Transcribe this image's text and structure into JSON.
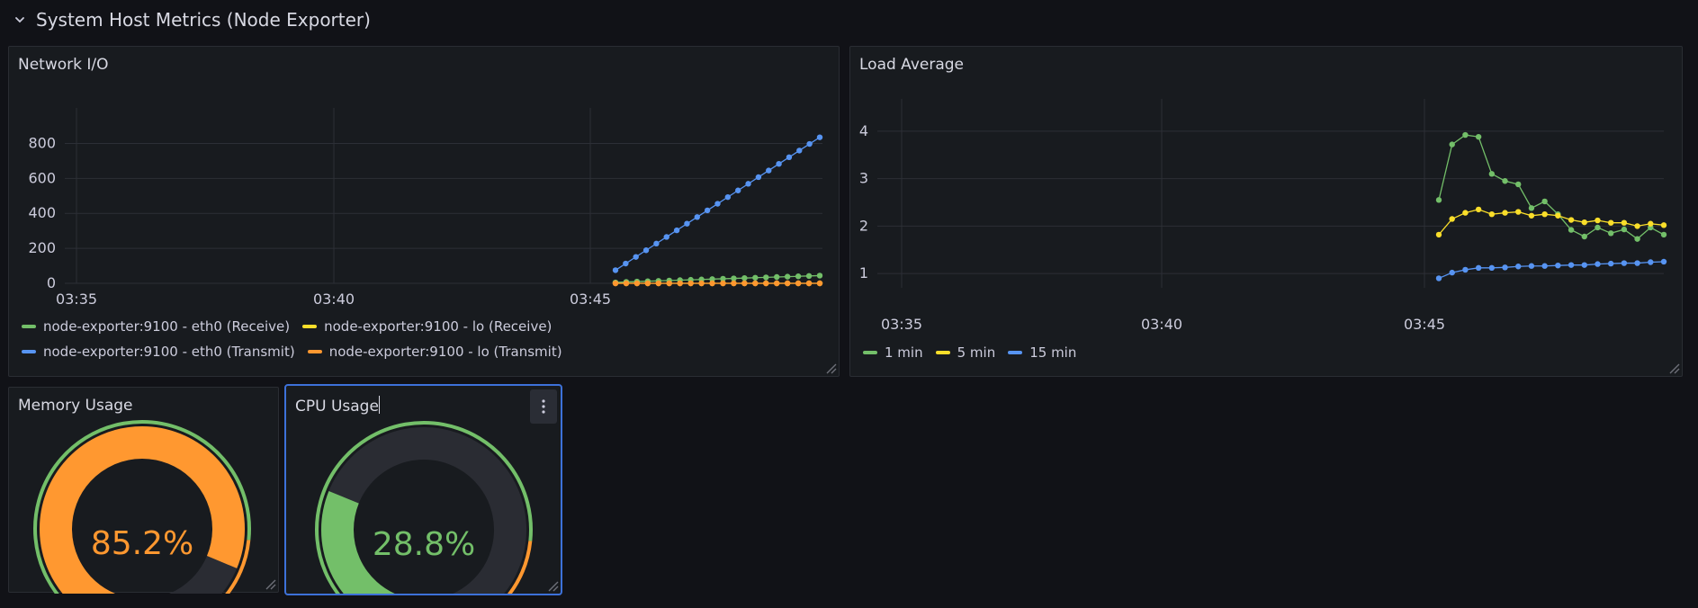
{
  "row": {
    "title": "System Host Metrics (Node Exporter)"
  },
  "colors": {
    "green": "#73bf69",
    "yellow": "#fade2a",
    "blue": "#5794f2",
    "orange": "#ff9830",
    "red": "#f2495c",
    "track": "#2a2c33"
  },
  "network": {
    "title": "Network I/O",
    "legend": [
      {
        "label": "node-exporter:9100 - eth0 (Receive)",
        "color": "#73bf69"
      },
      {
        "label": "node-exporter:9100 - lo (Receive)",
        "color": "#fade2a"
      },
      {
        "label": "node-exporter:9100 - eth0 (Transmit)",
        "color": "#5794f2"
      },
      {
        "label": "node-exporter:9100 - lo (Transmit)",
        "color": "#ff9830"
      }
    ],
    "chart_data": {
      "type": "line",
      "xlabels": [
        "03:35",
        "03:40",
        "03:45"
      ],
      "ylim": [
        0,
        900
      ],
      "yticks": [
        0,
        200,
        400,
        600,
        800
      ],
      "series": [
        {
          "name": "node-exporter:9100 - eth0 (Receive)",
          "color": "#73bf69",
          "values": [
            5,
            8,
            10,
            12,
            14,
            16,
            18,
            20,
            22,
            24,
            26,
            28,
            30,
            32,
            34,
            36,
            38,
            40,
            42,
            44
          ]
        },
        {
          "name": "node-exporter:9100 - lo (Receive)",
          "color": "#fade2a",
          "values": [
            0,
            0,
            0,
            0,
            0,
            0,
            0,
            0,
            0,
            0,
            0,
            0,
            0,
            0,
            0,
            0,
            0,
            0,
            0,
            0
          ]
        },
        {
          "name": "node-exporter:9100 - eth0 (Transmit)",
          "color": "#5794f2",
          "values": [
            75,
            113,
            151,
            189,
            227,
            265,
            303,
            341,
            379,
            417,
            455,
            493,
            531,
            569,
            607,
            645,
            683,
            721,
            759,
            797,
            835
          ]
        },
        {
          "name": "node-exporter:9100 - lo (Transmit)",
          "color": "#ff9830",
          "values": [
            0,
            0,
            0,
            0,
            0,
            0,
            0,
            0,
            0,
            0,
            0,
            0,
            0,
            0,
            0,
            0,
            0,
            0,
            0,
            0
          ]
        }
      ]
    }
  },
  "load": {
    "title": "Load Average",
    "legend": [
      {
        "label": "1 min",
        "color": "#73bf69"
      },
      {
        "label": "5 min",
        "color": "#fade2a"
      },
      {
        "label": "15 min",
        "color": "#5794f2"
      }
    ],
    "chart_data": {
      "type": "line",
      "xlabels": [
        "03:35",
        "03:40",
        "03:45"
      ],
      "ylim": [
        0.7,
        4.3
      ],
      "yticks": [
        1,
        2,
        3,
        4
      ],
      "series": [
        {
          "name": "1 min",
          "color": "#73bf69",
          "values": [
            2.55,
            3.72,
            3.92,
            3.88,
            3.1,
            2.95,
            2.88,
            2.38,
            2.52,
            2.25,
            1.92,
            1.78,
            1.97,
            1.85,
            1.93,
            1.73,
            1.97,
            1.82
          ]
        },
        {
          "name": "5 min",
          "color": "#fade2a",
          "values": [
            1.82,
            2.15,
            2.28,
            2.35,
            2.25,
            2.28,
            2.3,
            2.22,
            2.25,
            2.22,
            2.13,
            2.08,
            2.12,
            2.07,
            2.07,
            2.0,
            2.05,
            2.02
          ]
        },
        {
          "name": "15 min",
          "color": "#5794f2",
          "values": [
            0.9,
            1.02,
            1.08,
            1.12,
            1.12,
            1.13,
            1.15,
            1.16,
            1.16,
            1.17,
            1.18,
            1.18,
            1.2,
            1.21,
            1.22,
            1.22,
            1.24,
            1.25
          ]
        }
      ]
    }
  },
  "memory": {
    "title": "Memory Usage",
    "value": 85.2,
    "display": "85.2%",
    "color": "#ff9830"
  },
  "cpu": {
    "title": "CPU Usage",
    "value": 28.8,
    "display": "28.8%",
    "color": "#73bf69"
  }
}
